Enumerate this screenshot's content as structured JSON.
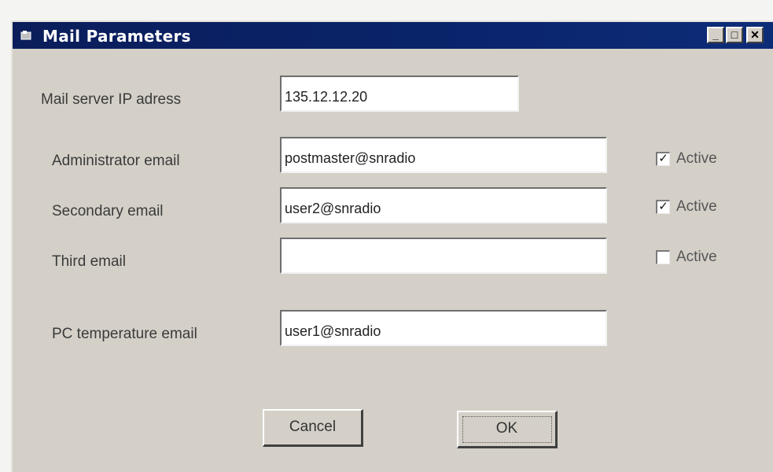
{
  "window": {
    "title": "Mail Parameters"
  },
  "titlebar_buttons": {
    "minimize": "_",
    "maximize": "□",
    "close": "✕"
  },
  "fields": {
    "mail_server": {
      "label": "Mail server IP adress",
      "value": "135.12.12.20"
    },
    "admin_email": {
      "label": "Administrator email",
      "value": "postmaster@snradio",
      "active_label": "Active",
      "active": true
    },
    "secondary_email": {
      "label": "Secondary email",
      "value": "user2@snradio",
      "active_label": "Active",
      "active": true
    },
    "third_email": {
      "label": "Third email",
      "value": "",
      "active_label": "Active",
      "active": false
    },
    "pc_temp_email": {
      "label": "PC temperature email",
      "value": "user1@snradio"
    }
  },
  "buttons": {
    "cancel": "Cancel",
    "ok": "OK"
  },
  "colors": {
    "titlebar": "#0a246a",
    "window_face": "#d4d0c8"
  }
}
